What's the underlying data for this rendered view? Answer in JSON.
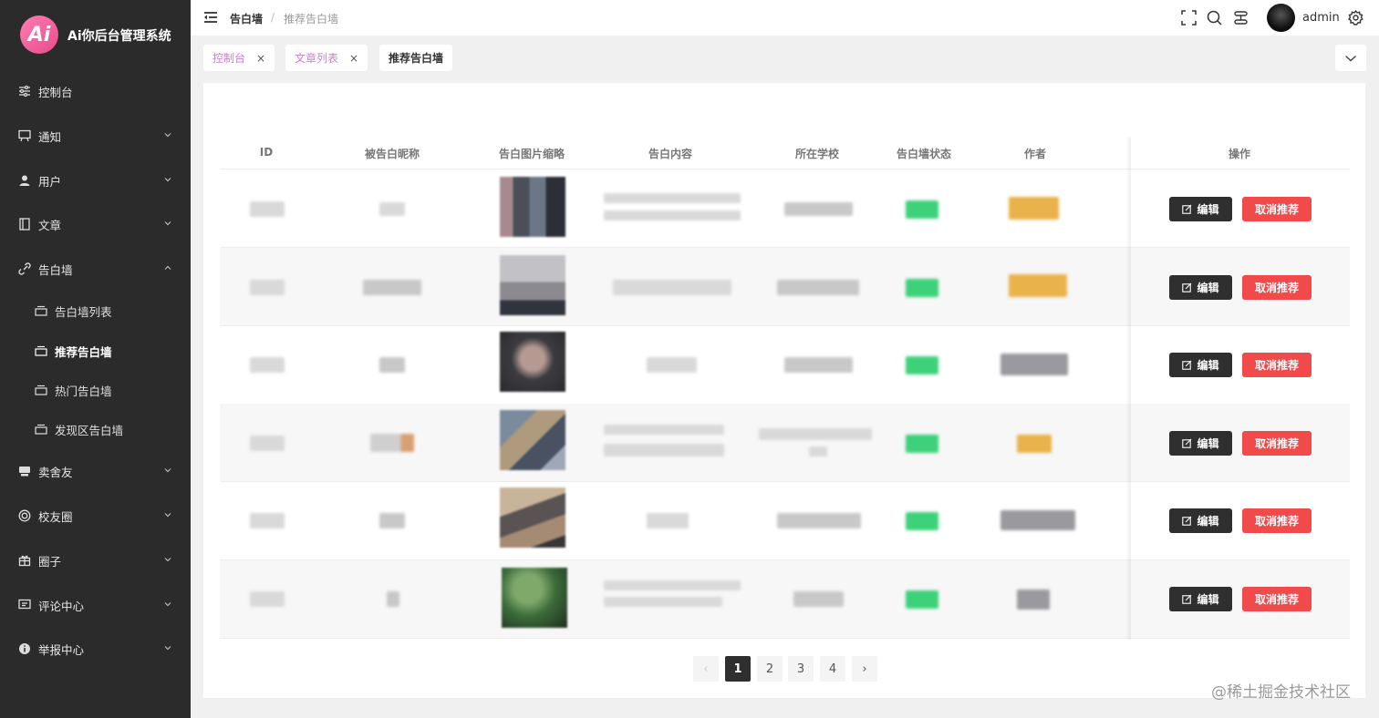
{
  "app": {
    "logo_text": "Ai",
    "title": "Ai你后台管理系统"
  },
  "sidebar": {
    "items": [
      {
        "label": "控制台",
        "icon": "sliders-icon"
      },
      {
        "label": "通知",
        "icon": "easel-icon"
      },
      {
        "label": "用户",
        "icon": "user-icon"
      },
      {
        "label": "文章",
        "icon": "book-icon"
      },
      {
        "label": "告白墙",
        "icon": "link-icon"
      },
      {
        "label": "卖舍友",
        "icon": "store-icon"
      },
      {
        "label": "校友圈",
        "icon": "circle-icon"
      },
      {
        "label": "圈子",
        "icon": "gift-icon"
      },
      {
        "label": "评论中心",
        "icon": "chat-icon"
      },
      {
        "label": "举报中心",
        "icon": "info-icon"
      }
    ],
    "sub_items": [
      {
        "label": "告白墙列表"
      },
      {
        "label": "推荐告白墙"
      },
      {
        "label": "热门告白墙"
      },
      {
        "label": "发现区告白墙"
      }
    ]
  },
  "header": {
    "breadcrumb": [
      "告白墙",
      "推荐告白墙"
    ],
    "breadcrumb_sep": "/",
    "username": "admin"
  },
  "tabs": [
    {
      "label": "控制台",
      "close": "×"
    },
    {
      "label": "文章列表",
      "close": "×"
    },
    {
      "label": "推荐告白墙"
    }
  ],
  "table": {
    "columns": [
      "ID",
      "被告白昵称",
      "告白图片缩略",
      "告白内容",
      "所在学校",
      "告白墙状态",
      "作者",
      "操作"
    ],
    "edit_label": "编辑",
    "cancel_label": "取消推荐"
  },
  "pagination": {
    "prev": "‹",
    "pages": [
      "1",
      "2",
      "3",
      "4"
    ],
    "next": "›",
    "current": "1"
  },
  "watermark": "@稀土掘金技术社区",
  "colors": {
    "sidebar_bg": "#2b2b2b",
    "accent_red": "#f04a4a",
    "dark_button": "#2f2f2f",
    "tab_pink": "#c97fcf"
  }
}
